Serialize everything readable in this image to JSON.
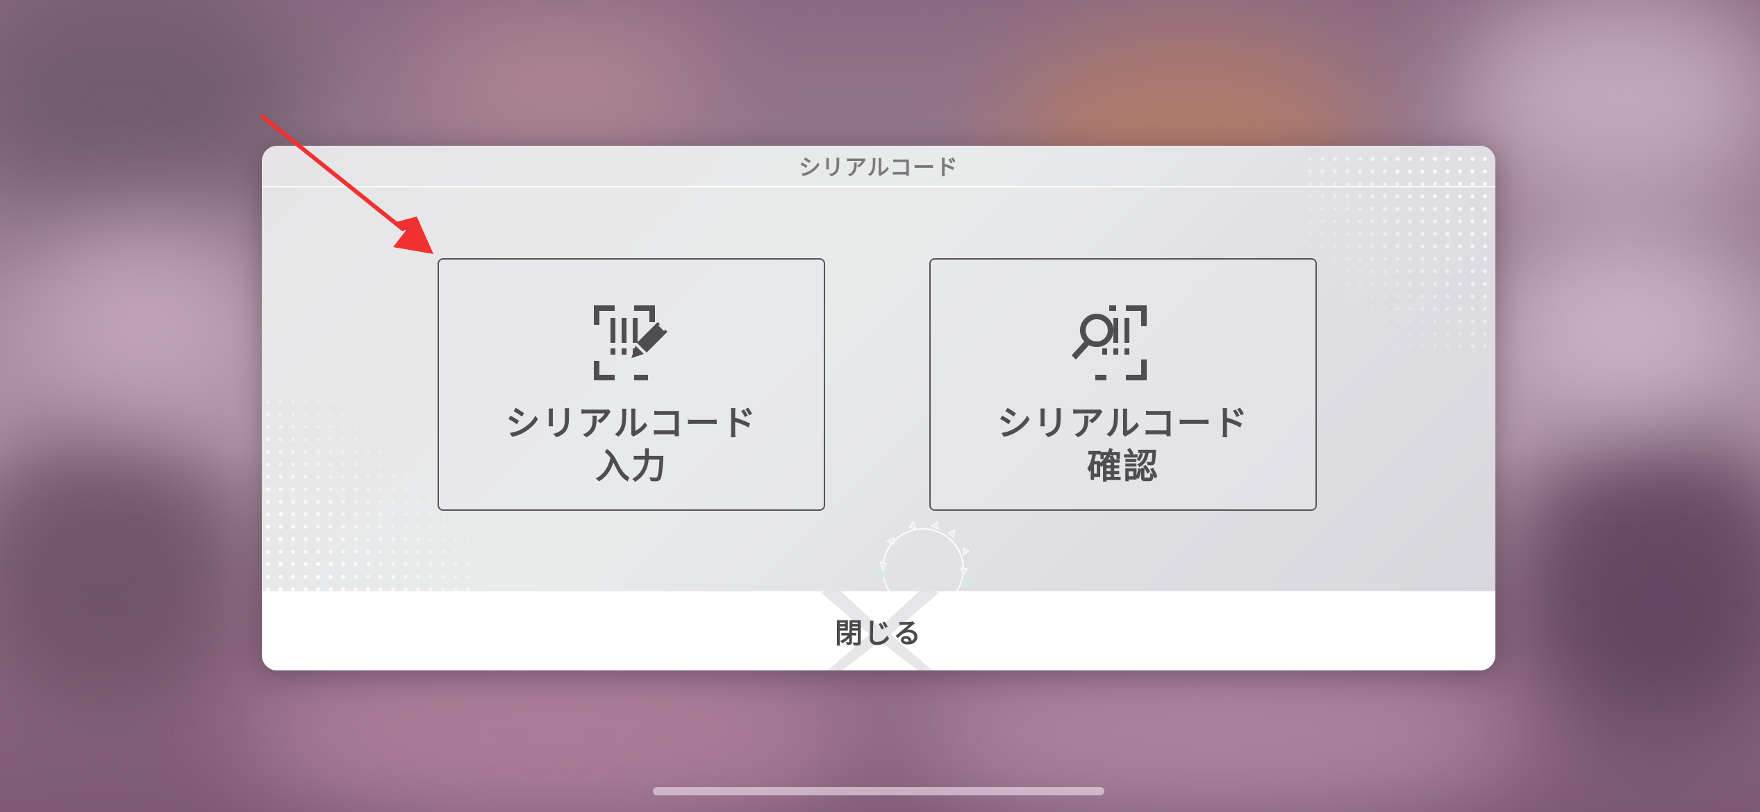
{
  "modal": {
    "title": "シリアルコード",
    "options": [
      {
        "line1": "シリアルコード",
        "line2": "入力",
        "icon": "serial-code-edit-icon"
      },
      {
        "line1": "シリアルコード",
        "line2": "確認",
        "icon": "serial-code-search-icon"
      }
    ],
    "close_label": "閉じる"
  },
  "annotation": {
    "arrow_color": "#f0312f"
  },
  "colors": {
    "text": "#4e4e50",
    "title": "#7a7a7e",
    "border": "#545454"
  }
}
